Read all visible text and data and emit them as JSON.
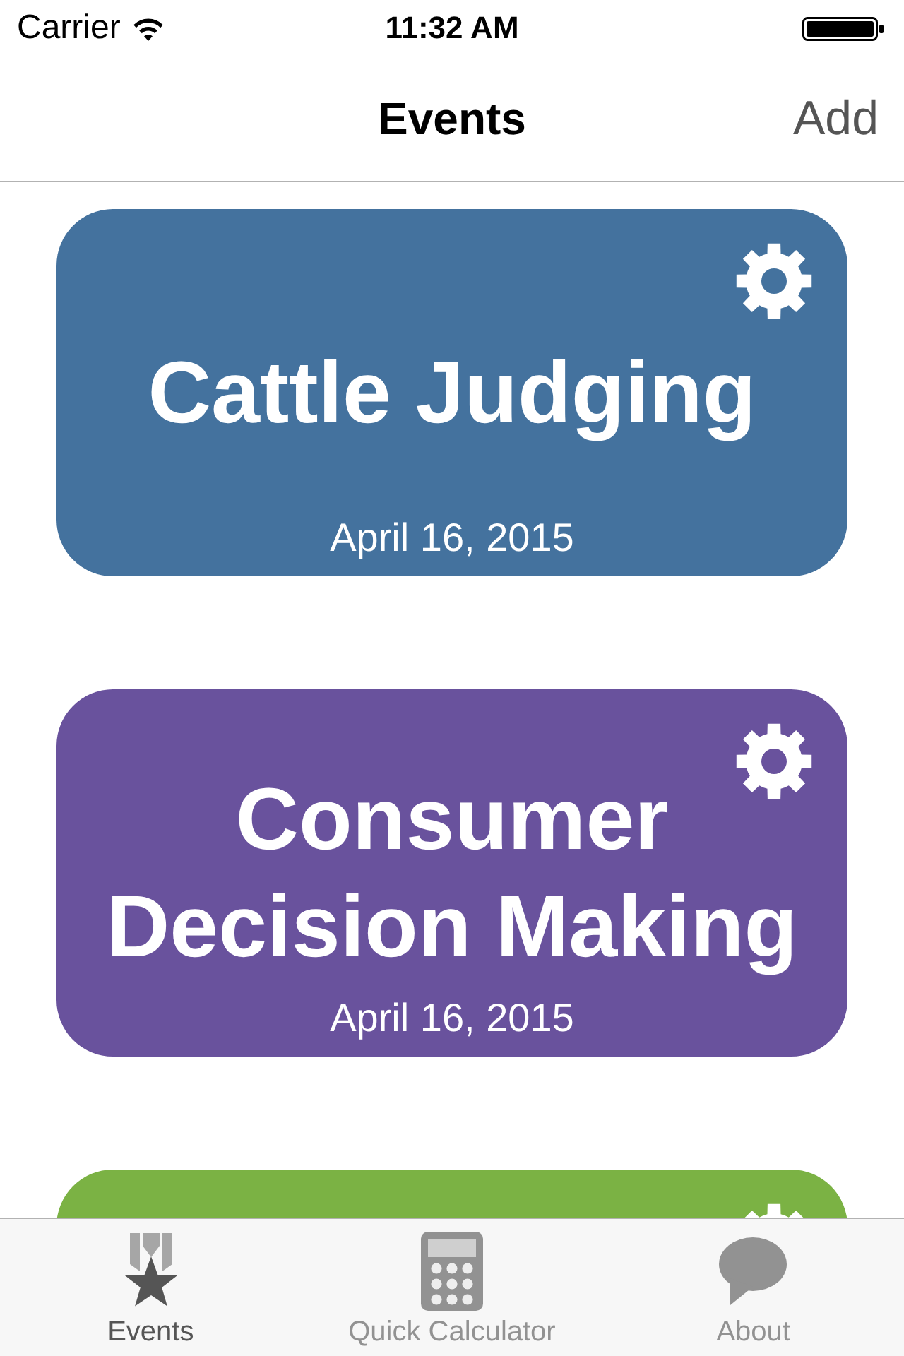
{
  "status_bar": {
    "carrier": "Carrier",
    "time": "11:32 AM"
  },
  "nav_bar": {
    "title": "Events",
    "action": "Add"
  },
  "events": [
    {
      "title": "Cattle Judging",
      "date": "April 16, 2015",
      "color": "#44729e"
    },
    {
      "title": "Consumer Decision Making",
      "date": "April 16, 2015",
      "color": "#69529d"
    },
    {
      "color": "#7bb244"
    }
  ],
  "tab_bar": [
    {
      "kind": "medal",
      "label": "Events",
      "selected": true
    },
    {
      "kind": "calculator",
      "label": "Quick Calculator",
      "selected": false
    },
    {
      "kind": "speech",
      "label": "About",
      "selected": false
    }
  ]
}
